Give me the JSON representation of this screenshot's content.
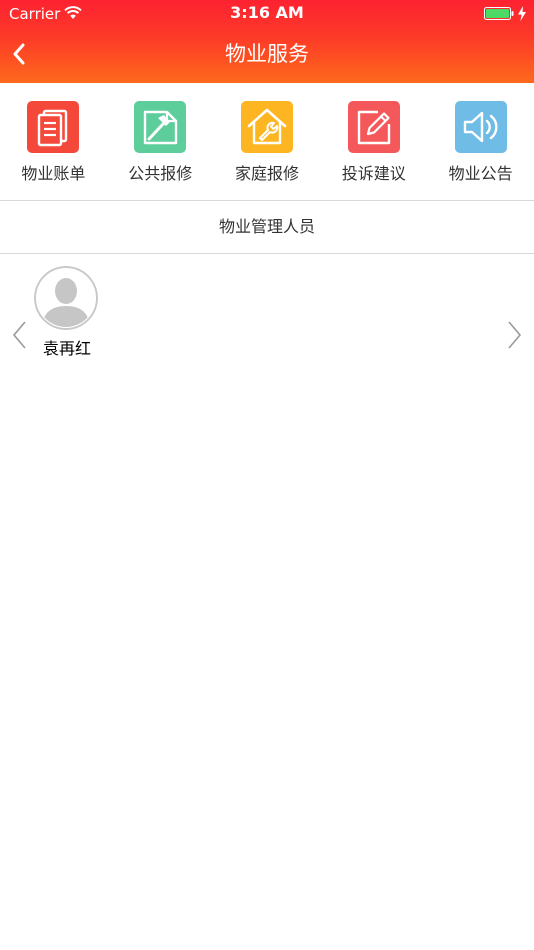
{
  "status_bar": {
    "carrier": "Carrier",
    "time": "3:16 AM"
  },
  "nav": {
    "title": "物业服务",
    "back_icon": "chevron-left-icon"
  },
  "colors": {
    "header_top": "#fd2231",
    "header_bottom": "#fd6a1c",
    "bill": "#f4493a",
    "public_repair": "#5ccd9b",
    "home_repair": "#fdb622",
    "complaint": "#f4585a",
    "notice": "#6fbce6"
  },
  "services": [
    {
      "label": "物业账单",
      "icon": "document-list-icon",
      "color": "#f4493a"
    },
    {
      "label": "公共报修",
      "icon": "hammer-icon",
      "color": "#5ccd9b"
    },
    {
      "label": "家庭报修",
      "icon": "house-wrench-icon",
      "color": "#fdb622"
    },
    {
      "label": "投诉建议",
      "icon": "edit-pencil-icon",
      "color": "#f4585a"
    },
    {
      "label": "物业公告",
      "icon": "speaker-icon",
      "color": "#6fbce6"
    }
  ],
  "section": {
    "title": "物业管理人员"
  },
  "staff": [
    {
      "name": "袁再红",
      "avatar": "default-avatar-icon"
    }
  ]
}
